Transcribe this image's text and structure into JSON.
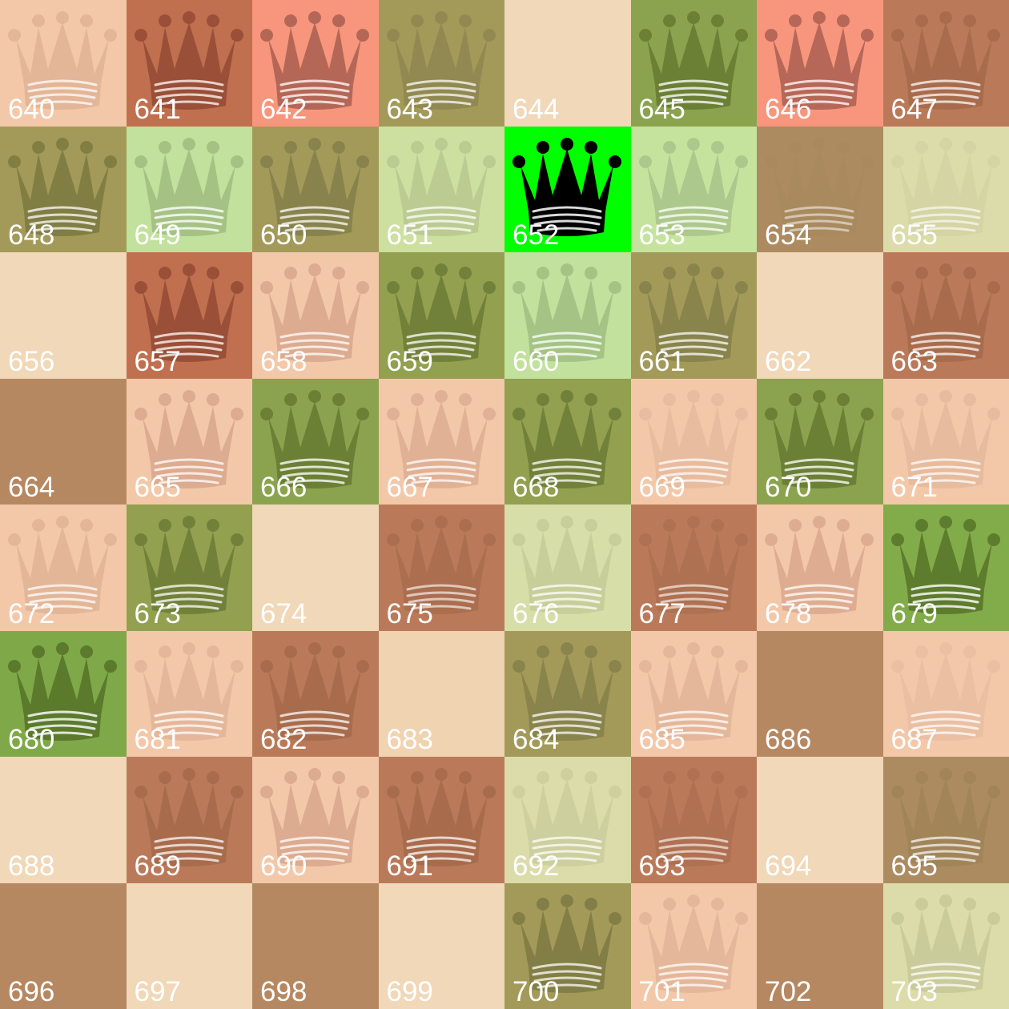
{
  "board": {
    "columns": 8,
    "cells": [
      {
        "label": "640",
        "bg": "#f3c8a9",
        "queen": true,
        "queen_color": "#e1b396",
        "opacity": 0.85
      },
      {
        "label": "641",
        "bg": "#c0704f",
        "queen": true,
        "queen_color": "#944a34",
        "opacity": 0.85
      },
      {
        "label": "642",
        "bg": "#f7967c",
        "queen": true,
        "queen_color": "#aa5f51",
        "opacity": 0.85
      },
      {
        "label": "643",
        "bg": "#a39a5a",
        "queen": true,
        "queen_color": "#8f8750",
        "opacity": 0.85
      },
      {
        "label": "644",
        "bg": "#f0d8b8",
        "queen": false,
        "queen_color": "",
        "opacity": 0
      },
      {
        "label": "645",
        "bg": "#8ba34e",
        "queen": true,
        "queen_color": "#687d33",
        "opacity": 0.9
      },
      {
        "label": "646",
        "bg": "#f7967c",
        "queen": true,
        "queen_color": "#ab5f52",
        "opacity": 0.85
      },
      {
        "label": "647",
        "bg": "#ba7a5a",
        "queen": true,
        "queen_color": "#a56a4b",
        "opacity": 0.85
      },
      {
        "label": "648",
        "bg": "#a39a5a",
        "queen": true,
        "queen_color": "#7a7a3f",
        "opacity": 0.85
      },
      {
        "label": "649",
        "bg": "#c1e19c",
        "queen": true,
        "queen_color": "#a3bf82",
        "opacity": 0.9
      },
      {
        "label": "650",
        "bg": "#a39a5a",
        "queen": true,
        "queen_color": "#84804a",
        "opacity": 0.85
      },
      {
        "label": "651",
        "bg": "#cde0a0",
        "queen": true,
        "queen_color": "#b8c890",
        "opacity": 0.85
      },
      {
        "label": "652",
        "bg": "#00ff00",
        "queen": true,
        "queen_color": "#000000",
        "opacity": 1
      },
      {
        "label": "653",
        "bg": "#c6e39e",
        "queen": true,
        "queen_color": "#a9c48a",
        "opacity": 0.85
      },
      {
        "label": "654",
        "bg": "#ad8b60",
        "queen": true,
        "queen_color": "#a78a5e",
        "opacity": 0.6
      },
      {
        "label": "655",
        "bg": "#dcdcaa",
        "queen": true,
        "queen_color": "#d2d1a2",
        "opacity": 0.7
      },
      {
        "label": "656",
        "bg": "#f0d8b8",
        "queen": false,
        "queen_color": "",
        "opacity": 0
      },
      {
        "label": "657",
        "bg": "#c0704f",
        "queen": true,
        "queen_color": "#944a34",
        "opacity": 0.85
      },
      {
        "label": "658",
        "bg": "#f3c8a9",
        "queen": true,
        "queen_color": "#d9a68c",
        "opacity": 0.85
      },
      {
        "label": "659",
        "bg": "#92a050",
        "queen": true,
        "queen_color": "#6d7c35",
        "opacity": 0.85
      },
      {
        "label": "660",
        "bg": "#c1e19c",
        "queen": true,
        "queen_color": "#9fbe80",
        "opacity": 0.85
      },
      {
        "label": "661",
        "bg": "#a39a5a",
        "queen": true,
        "queen_color": "#85814a",
        "opacity": 0.85
      },
      {
        "label": "662",
        "bg": "#f0d8b8",
        "queen": false,
        "queen_color": "",
        "opacity": 0
      },
      {
        "label": "663",
        "bg": "#ba7a5a",
        "queen": true,
        "queen_color": "#a56a4b",
        "opacity": 0.85
      },
      {
        "label": "664",
        "bg": "#b58862",
        "queen": false,
        "queen_color": "",
        "opacity": 0
      },
      {
        "label": "665",
        "bg": "#f3c8a9",
        "queen": true,
        "queen_color": "#d9a68c",
        "opacity": 0.85
      },
      {
        "label": "666",
        "bg": "#8ba34e",
        "queen": true,
        "queen_color": "#687d33",
        "opacity": 0.9
      },
      {
        "label": "667",
        "bg": "#f3c8a9",
        "queen": true,
        "queen_color": "#ddae91",
        "opacity": 0.85
      },
      {
        "label": "668",
        "bg": "#92a050",
        "queen": true,
        "queen_color": "#6d7c35",
        "opacity": 0.85
      },
      {
        "label": "669",
        "bg": "#f3c8a9",
        "queen": true,
        "queen_color": "#e7bb9d",
        "opacity": 0.85
      },
      {
        "label": "670",
        "bg": "#8ba34e",
        "queen": true,
        "queen_color": "#687d33",
        "opacity": 0.9
      },
      {
        "label": "671",
        "bg": "#f3c8a9",
        "queen": true,
        "queen_color": "#e5b99b",
        "opacity": 0.85
      },
      {
        "label": "672",
        "bg": "#f3c8a9",
        "queen": true,
        "queen_color": "#e1b396",
        "opacity": 0.85
      },
      {
        "label": "673",
        "bg": "#92a050",
        "queen": true,
        "queen_color": "#6d7c35",
        "opacity": 0.85
      },
      {
        "label": "674",
        "bg": "#f0d8b8",
        "queen": false,
        "queen_color": "",
        "opacity": 0
      },
      {
        "label": "675",
        "bg": "#ba7a5a",
        "queen": true,
        "queen_color": "#a56a4b",
        "opacity": 0.7
      },
      {
        "label": "676",
        "bg": "#d8dea8",
        "queen": true,
        "queen_color": "#c5cc98",
        "opacity": 0.85
      },
      {
        "label": "677",
        "bg": "#ba7a5a",
        "queen": true,
        "queen_color": "#aa6e4f",
        "opacity": 0.7
      },
      {
        "label": "678",
        "bg": "#f3c8a9",
        "queen": true,
        "queen_color": "#dba98d",
        "opacity": 0.85
      },
      {
        "label": "679",
        "bg": "#82ab4a",
        "queen": true,
        "queen_color": "#5d7a2c",
        "opacity": 0.95
      },
      {
        "label": "680",
        "bg": "#7fa848",
        "queen": true,
        "queen_color": "#5a782b",
        "opacity": 0.95
      },
      {
        "label": "681",
        "bg": "#f3c8a9",
        "queen": true,
        "queen_color": "#e3b598",
        "opacity": 0.85
      },
      {
        "label": "682",
        "bg": "#ba7a5a",
        "queen": true,
        "queen_color": "#a56a4b",
        "opacity": 0.85
      },
      {
        "label": "683",
        "bg": "#f0d3b0",
        "queen": false,
        "queen_color": "",
        "opacity": 0
      },
      {
        "label": "684",
        "bg": "#a39a5a",
        "queen": true,
        "queen_color": "#85814a",
        "opacity": 0.85
      },
      {
        "label": "685",
        "bg": "#f3c8a9",
        "queen": true,
        "queen_color": "#e3b598",
        "opacity": 0.85
      },
      {
        "label": "686",
        "bg": "#b58862",
        "queen": false,
        "queen_color": "",
        "opacity": 0
      },
      {
        "label": "687",
        "bg": "#f3c8a9",
        "queen": true,
        "queen_color": "#e9bea1",
        "opacity": 0.85
      },
      {
        "label": "688",
        "bg": "#f0d8b8",
        "queen": false,
        "queen_color": "",
        "opacity": 0
      },
      {
        "label": "689",
        "bg": "#ba7a5a",
        "queen": true,
        "queen_color": "#a56a4b",
        "opacity": 0.85
      },
      {
        "label": "690",
        "bg": "#f3c8a9",
        "queen": true,
        "queen_color": "#d9a68c",
        "opacity": 0.85
      },
      {
        "label": "691",
        "bg": "#ba7a5a",
        "queen": true,
        "queen_color": "#a56a4b",
        "opacity": 0.85
      },
      {
        "label": "692",
        "bg": "#dcdcaa",
        "queen": true,
        "queen_color": "#cbcd9c",
        "opacity": 0.85
      },
      {
        "label": "693",
        "bg": "#ba7a5a",
        "queen": true,
        "queen_color": "#ab6e4f",
        "opacity": 0.7
      },
      {
        "label": "694",
        "bg": "#f0d8b8",
        "queen": false,
        "queen_color": "",
        "opacity": 0
      },
      {
        "label": "695",
        "bg": "#ad8b60",
        "queen": true,
        "queen_color": "#9f8458",
        "opacity": 0.8
      },
      {
        "label": "696",
        "bg": "#b58862",
        "queen": false,
        "queen_color": "",
        "opacity": 0
      },
      {
        "label": "697",
        "bg": "#f0d8b8",
        "queen": false,
        "queen_color": "",
        "opacity": 0
      },
      {
        "label": "698",
        "bg": "#b58862",
        "queen": false,
        "queen_color": "",
        "opacity": 0
      },
      {
        "label": "699",
        "bg": "#f0d8b8",
        "queen": false,
        "queen_color": "",
        "opacity": 0
      },
      {
        "label": "700",
        "bg": "#a39a5a",
        "queen": true,
        "queen_color": "#7d7a42",
        "opacity": 0.85
      },
      {
        "label": "701",
        "bg": "#f3c8a9",
        "queen": true,
        "queen_color": "#e3b598",
        "opacity": 0.85
      },
      {
        "label": "702",
        "bg": "#b58862",
        "queen": false,
        "queen_color": "",
        "opacity": 0
      },
      {
        "label": "703",
        "bg": "#dcdcaa",
        "queen": true,
        "queen_color": "#c8c998",
        "opacity": 0.85
      }
    ]
  },
  "icons": {
    "queen": "queen-icon"
  }
}
